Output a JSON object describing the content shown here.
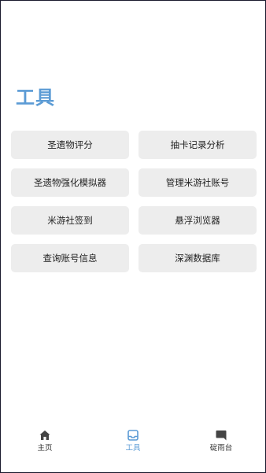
{
  "page": {
    "title": "工具"
  },
  "tools": [
    {
      "label": "圣遗物评分"
    },
    {
      "label": "抽卡记录分析"
    },
    {
      "label": "圣遗物强化模拟器"
    },
    {
      "label": "管理米游社账号"
    },
    {
      "label": "米游社签到"
    },
    {
      "label": "悬浮浏览器"
    },
    {
      "label": "查询账号信息"
    },
    {
      "label": "深渊数据库"
    }
  ],
  "bottom_nav": {
    "active": "tools",
    "items": [
      {
        "id": "home",
        "label": "主页",
        "icon": "home-icon"
      },
      {
        "id": "tools",
        "label": "工具",
        "icon": "inbox-tray-icon"
      },
      {
        "id": "chat",
        "label": "碇雨台",
        "icon": "chat-bubble-icon"
      }
    ]
  },
  "colors": {
    "accent": "#5b9bd5",
    "button_bg": "#ededed",
    "text": "#222222",
    "nav_text": "#333333"
  }
}
